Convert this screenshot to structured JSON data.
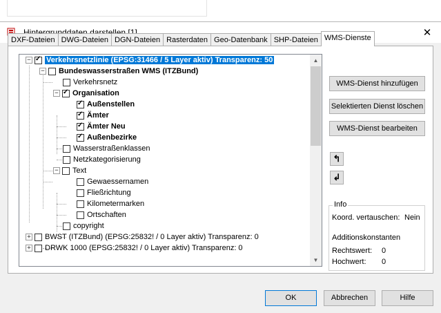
{
  "dialog": {
    "title": "Hintergrunddaten darstellen [1]",
    "close_glyph": "✕",
    "icon": "app-layer-icon"
  },
  "tabs": [
    {
      "label": "DXF-Dateien",
      "active": false
    },
    {
      "label": "DWG-Dateien",
      "active": false
    },
    {
      "label": "DGN-Dateien",
      "active": false
    },
    {
      "label": "Rasterdaten",
      "active": false
    },
    {
      "label": "Geo-Datenbank",
      "active": false
    },
    {
      "label": "SHP-Dateien",
      "active": false
    },
    {
      "label": "WMS-Dienste",
      "active": true
    }
  ],
  "tree": [
    {
      "label": "Verkehrsnetzlinie (EPSG:31466 / 5 Layer aktiv)  Transparenz: 50",
      "checked": true,
      "bold": true,
      "selected": true,
      "expanded": true,
      "level": 0
    },
    {
      "label": "Bundeswasserstraßen WMS (ITZBund)",
      "checked": false,
      "bold": true,
      "expanded": true,
      "level": 1
    },
    {
      "label": "Verkehrsnetz",
      "checked": false,
      "bold": false,
      "level": 2
    },
    {
      "label": "Organisation",
      "checked": true,
      "bold": true,
      "expanded": true,
      "level": 2
    },
    {
      "label": "Außenstellen",
      "checked": true,
      "bold": true,
      "level": 3
    },
    {
      "label": "Ämter",
      "checked": true,
      "bold": true,
      "level": 3
    },
    {
      "label": "Ämter Neu",
      "checked": true,
      "bold": true,
      "level": 3
    },
    {
      "label": "Außenbezirke",
      "checked": true,
      "bold": true,
      "level": 3
    },
    {
      "label": "Wasserstraßenklassen",
      "checked": false,
      "bold": false,
      "level": 2
    },
    {
      "label": "Netzkategorisierung",
      "checked": false,
      "bold": false,
      "level": 2
    },
    {
      "label": "Text",
      "checked": false,
      "bold": false,
      "expanded": true,
      "level": 2
    },
    {
      "label": "Gewaessernamen",
      "checked": false,
      "bold": false,
      "level": 3
    },
    {
      "label": "Fließrichtung",
      "checked": false,
      "bold": false,
      "level": 3
    },
    {
      "label": "Kilometermarken",
      "checked": false,
      "bold": false,
      "level": 3
    },
    {
      "label": "Ortschaften",
      "checked": false,
      "bold": false,
      "level": 3
    },
    {
      "label": "copyright",
      "checked": false,
      "bold": false,
      "level": 2
    },
    {
      "label": "BWST (ITZBund) (EPSG:25832! / 0 Layer aktiv)  Transparenz: 0",
      "checked": false,
      "bold": false,
      "expanded": false,
      "level": 0
    },
    {
      "label": "DRWK 1000 (EPSG:25832! / 0 Layer aktiv)  Transparenz: 0",
      "checked": false,
      "bold": false,
      "expanded": false,
      "level": 0
    }
  ],
  "buttons": {
    "add": "WMS-Dienst hinzufügen",
    "delete": "Selektierten Dienst löschen",
    "edit": "WMS-Dienst bearbeiten",
    "move_up_glyph": "↰",
    "move_down_glyph": "↲"
  },
  "info": {
    "legend": "Info",
    "swap_label": "Koord. vertauschen:",
    "swap_value": "Nein",
    "additions_label": "Additionskonstanten",
    "rechtswert_label": "Rechtswert:",
    "rechtswert_value": "0",
    "hochwert_label": "Hochwert:",
    "hochwert_value": "0"
  },
  "footer": {
    "ok": "OK",
    "cancel": "Abbrechen",
    "help": "Hilfe"
  }
}
